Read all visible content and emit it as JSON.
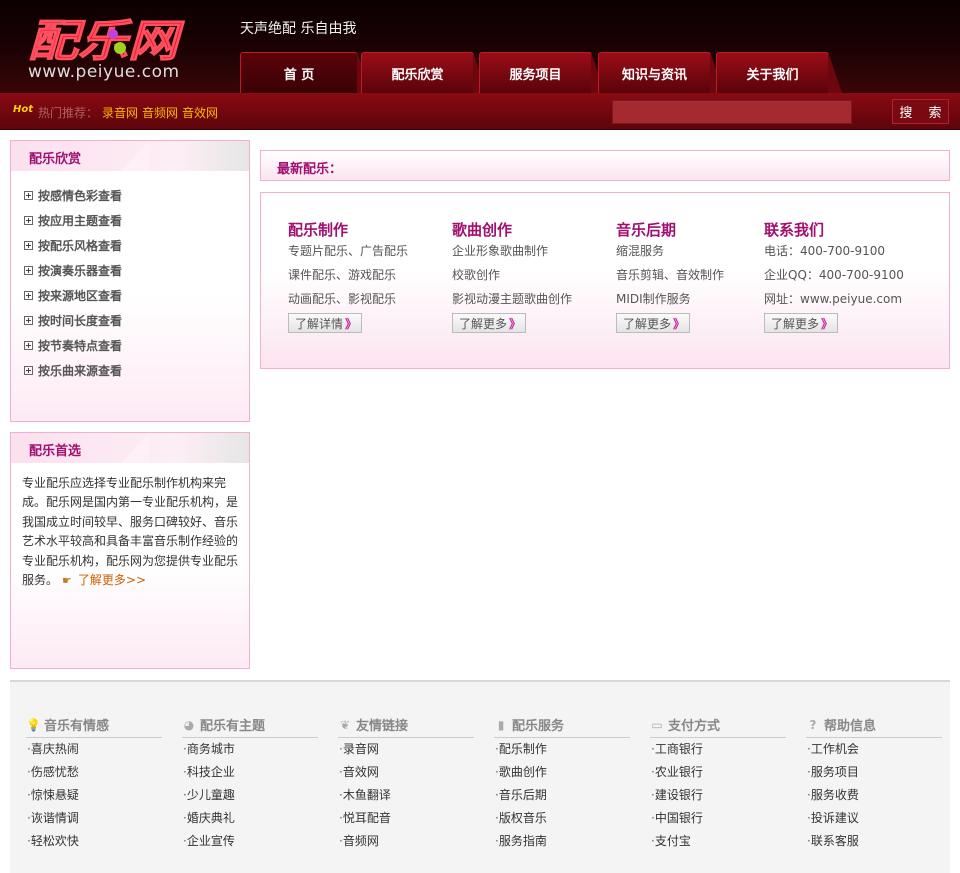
{
  "header": {
    "logo_text": "配乐网",
    "logo_url": "www.peiyue.com",
    "slogan": "天声绝配 乐自由我",
    "nav": [
      "首 页",
      "配乐欣赏",
      "服务项目",
      "知识与资讯",
      "关于我们"
    ]
  },
  "searchbar": {
    "hot_icon": "Hot",
    "hot_label": "热门推荐：",
    "hot_links": [
      "录音网",
      "音频网",
      "音效网"
    ],
    "search_value": "",
    "search_button": "搜 索"
  },
  "sidebar": {
    "appreciation": {
      "title": "配乐欣赏",
      "items": [
        "按感情色彩查看",
        "按应用主题查看",
        "按配乐风格查看",
        "按演奏乐器查看",
        "按来源地区查看",
        "按时间长度查看",
        "按节奏特点查看",
        "按乐曲来源查看"
      ]
    },
    "featured": {
      "title": "配乐首选",
      "text": "专业配乐应选择专业配乐制作机构来完成。配乐网是国内第一专业配乐机构，是我国成立时间较早、服务口碑较好、音乐艺术水平较高和具备丰富音乐制作经验的专业配乐机构，配乐网为您提供专业配乐服务。",
      "more": "了解更多>>"
    }
  },
  "main": {
    "latest_title": "最新配乐：",
    "columns": [
      {
        "title": "配乐制作",
        "lines": [
          "专题片配乐、广告配乐",
          "课件配乐、游戏配乐",
          "动画配乐、影视配乐"
        ],
        "button": "了解详情"
      },
      {
        "title": "歌曲创作",
        "lines": [
          "企业形象歌曲制作",
          "校歌创作",
          "影视动漫主题歌曲创作"
        ],
        "button": "了解更多"
      },
      {
        "title": "音乐后期",
        "lines": [
          "缩混服务",
          "音乐剪辑、音效制作",
          "MIDI制作服务"
        ],
        "button": "了解更多"
      },
      {
        "title": "联系我们",
        "lines": [
          "电话：400-700-9100",
          "企业QQ：400-700-9100",
          "网址：www.peiyue.com"
        ],
        "button": "了解更多"
      }
    ]
  },
  "footer": {
    "columns": [
      {
        "title": "音乐有情感",
        "icon": "bulb-icon",
        "items": [
          "喜庆热闹",
          "伤感忧愁",
          "惊悚悬疑",
          "诙谐情调",
          "轻松欢快"
        ]
      },
      {
        "title": "配乐有主题",
        "icon": "globe-icon",
        "items": [
          "商务城市",
          "科技企业",
          "少儿童趣",
          "婚庆典礼",
          "企业宣传"
        ]
      },
      {
        "title": "友情链接",
        "icon": "leaf-icon",
        "items": [
          "录音网",
          "音效网",
          "木鱼翻译",
          "悦耳配音",
          "音频网"
        ]
      },
      {
        "title": "配乐服务",
        "icon": "truck-icon",
        "items": [
          "配乐制作",
          "歌曲创作",
          "音乐后期",
          "版权音乐",
          "服务指南"
        ]
      },
      {
        "title": "支付方式",
        "icon": "card-icon",
        "items": [
          "工商银行",
          "农业银行",
          "建设银行",
          "中国银行",
          "支付宝"
        ]
      },
      {
        "title": "帮助信息",
        "icon": "help-icon",
        "items": [
          "工作机会",
          "服务项目",
          "服务收费",
          "投诉建议",
          "联系客服"
        ]
      }
    ]
  },
  "colors": {
    "brand_red": "#8a0a12",
    "accent_pink": "#a01070",
    "hot_link": "#ffb400",
    "logo_red": "#e8182a"
  }
}
